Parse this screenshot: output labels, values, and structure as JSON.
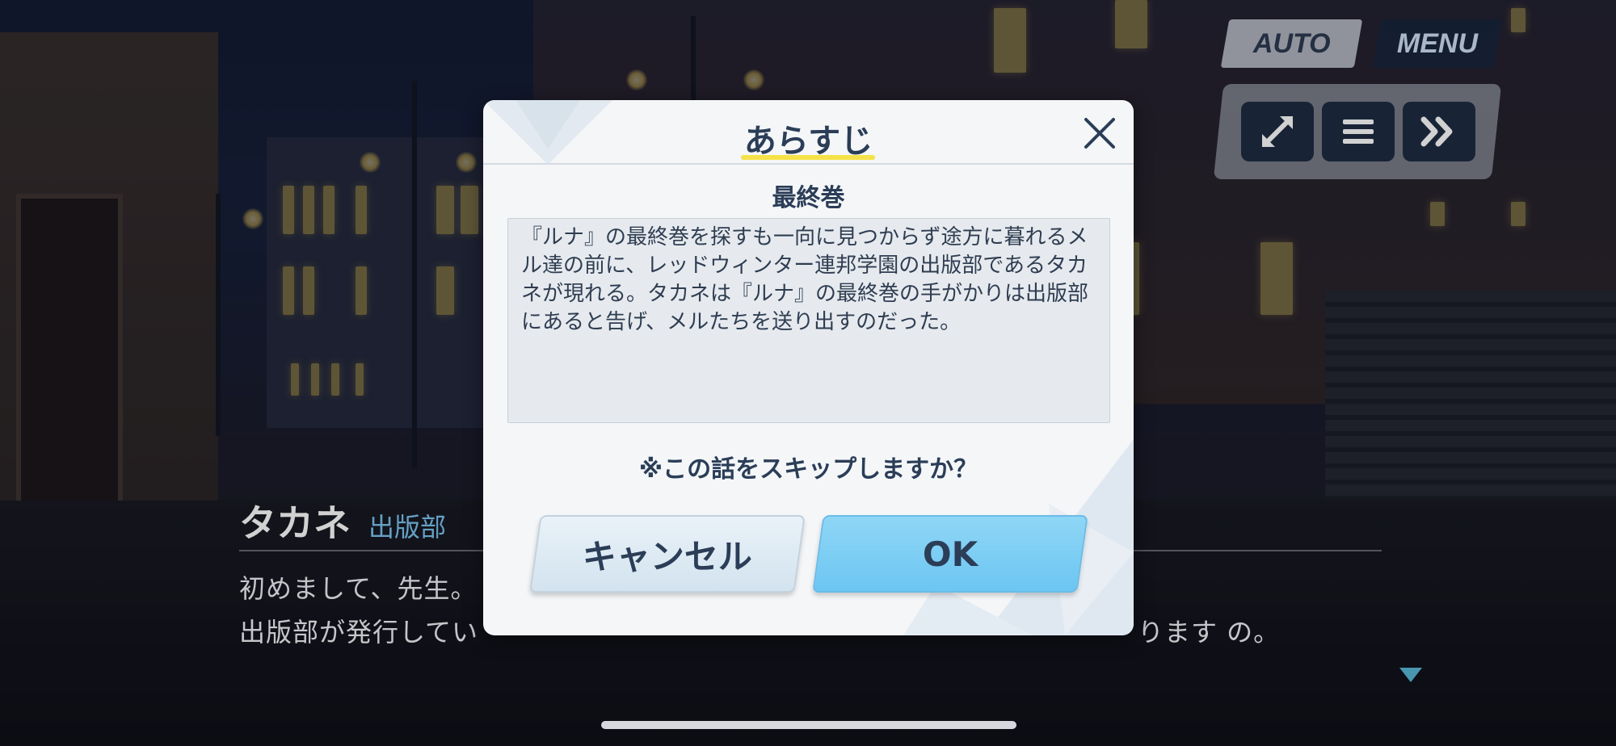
{
  "top_controls": {
    "auto_label": "AUTO",
    "menu_label": "MENU",
    "icons": [
      "fullscreen-icon",
      "log-icon",
      "fast-forward-icon"
    ]
  },
  "dialogue": {
    "speaker": "タカネ",
    "club": "出版部",
    "line1": "初めまして、先生。",
    "line2": "出版部が発行してい",
    "line2_tail": "ります の。"
  },
  "modal": {
    "title": "あらすじ",
    "chapter": "最終巻",
    "synopsis": "『ルナ』の最終巻を探すも一向に見つからず途方に暮れるメル達の前に、レッドウィンター連邦学園の出版部であるタカネが現れる。タカネは『ルナ』の最終巻の手がかりは出版部にあると告げ、メルたちを送り出すのだった。",
    "question": "※この話をスキップしますか？",
    "cancel_label": "キャンセル",
    "ok_label": "OK"
  },
  "colors": {
    "accent_yellow": "#f5e24a",
    "ok_blue": "#6cc6f2",
    "title_text": "#2b3d57"
  }
}
